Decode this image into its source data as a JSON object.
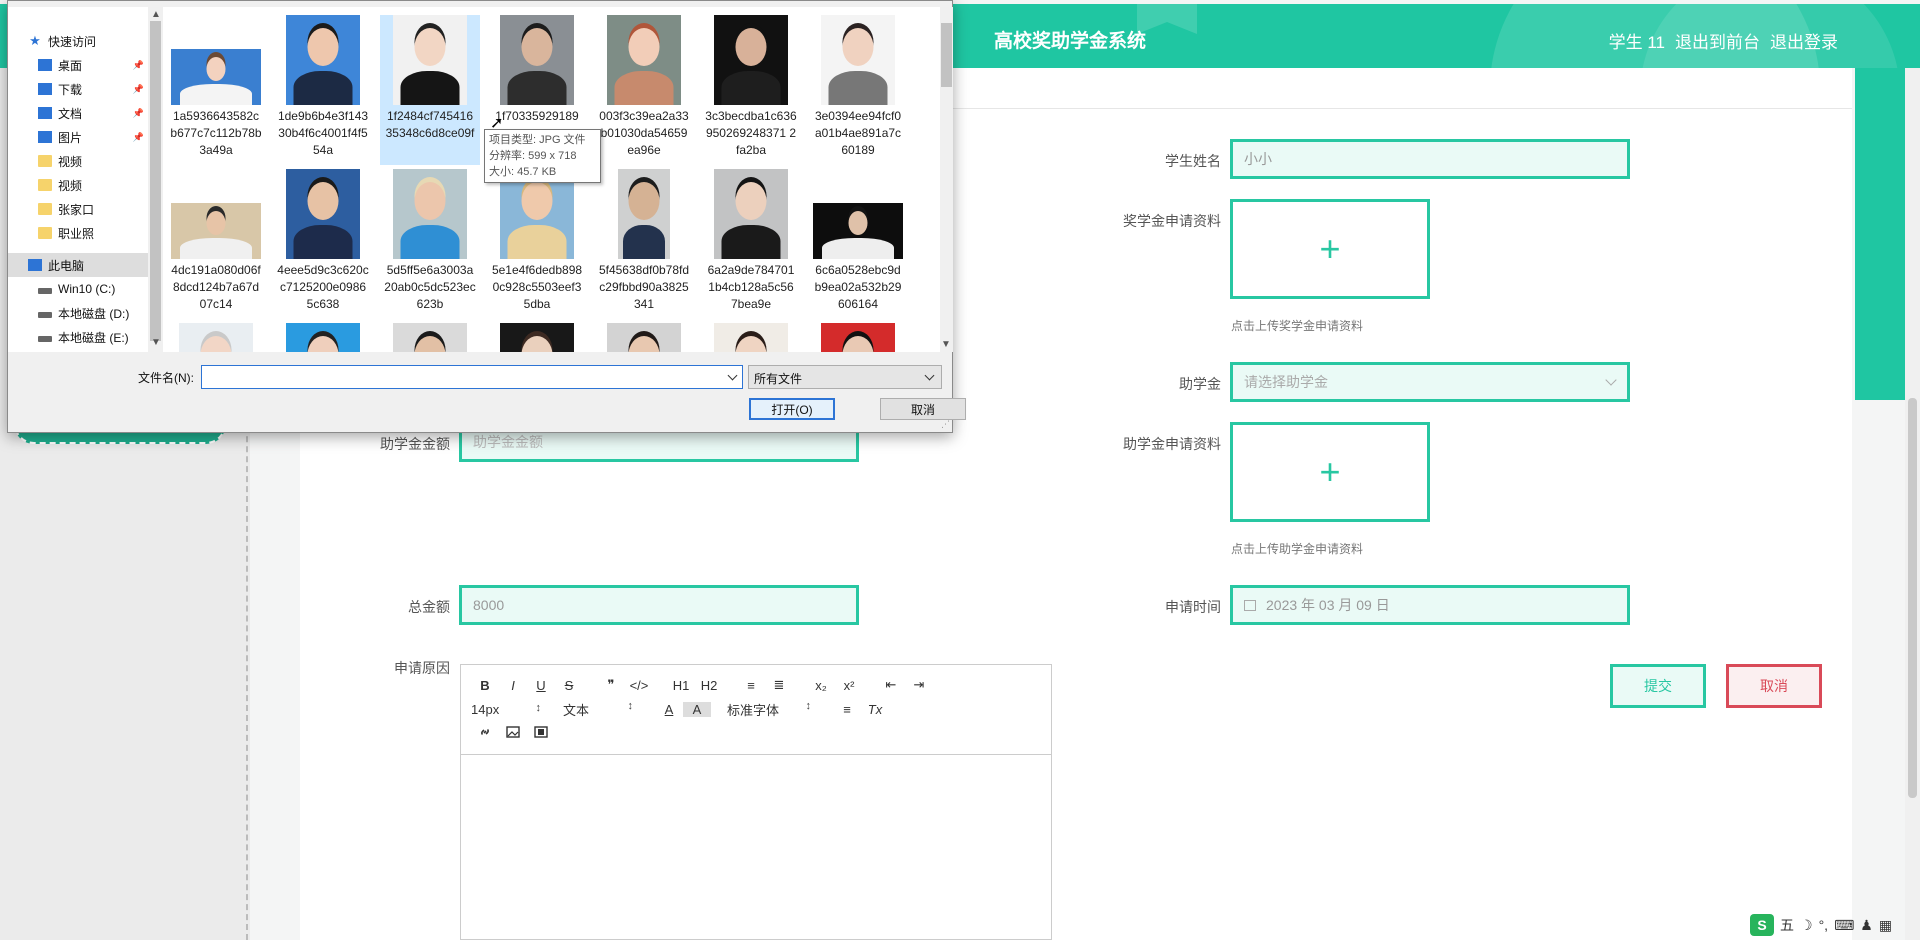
{
  "header": {
    "title": "高校奖助学金系统",
    "nav": [
      "学生 11",
      "退出到前台",
      "退出登录"
    ]
  },
  "form": {
    "student_name_label": "学生姓名",
    "student_name_value": "小小",
    "scholarship_material_label": "奖学金申请资料",
    "scholarship_hint": "点击上传奖学金申请资料",
    "grant_label": "助学金",
    "grant_placeholder": "请选择助学金",
    "grant_material_label": "助学金申请资料",
    "grant_hint": "点击上传助学金申请资料",
    "grant_amount_label": "助学金金额",
    "grant_amount_placeholder": "助学金金额",
    "total_label": "总金额",
    "total_value": "8000",
    "apply_time_label": "申请时间",
    "apply_time_value": "2023 年 03 月 09 日",
    "reason_label": "申请原因",
    "upload_plus": "+",
    "submit": "提交",
    "cancel": "取消"
  },
  "editor": {
    "row1": [
      "B",
      "I",
      "U",
      "S",
      "❞",
      "</>",
      "H1",
      "H2",
      "≡",
      "≣",
      "x₂",
      "x²",
      "⇤",
      "⇥"
    ],
    "font_size": "14px",
    "block_type": "文本",
    "font_color_icon": "A",
    "bg_color_icon": "A",
    "font_family": "标准字体",
    "align_icon": "≡",
    "clear_icon": "Tx",
    "row3_icons": [
      "link-icon",
      "image-icon",
      "video-icon"
    ]
  },
  "dialog": {
    "nav": [
      {
        "label": "快速访问",
        "icon": "star-icon"
      },
      {
        "label": "桌面",
        "icon": "desktop-icon",
        "pinned": true
      },
      {
        "label": "下载",
        "icon": "download-icon",
        "pinned": true
      },
      {
        "label": "文档",
        "icon": "document-icon",
        "pinned": true
      },
      {
        "label": "图片",
        "icon": "pictures-icon",
        "pinned": true
      },
      {
        "label": "视频",
        "icon": "folder-icon"
      },
      {
        "label": "视频",
        "icon": "folder-icon"
      },
      {
        "label": "张家口",
        "icon": "folder-icon"
      },
      {
        "label": "职业照",
        "icon": "folder-icon"
      },
      {
        "label": "此电脑",
        "icon": "computer-icon"
      },
      {
        "label": "Win10 (C:)",
        "icon": "drive-icon"
      },
      {
        "label": "本地磁盘 (D:)",
        "icon": "drive-icon"
      },
      {
        "label": "本地磁盘 (E:)",
        "icon": "drive-icon"
      }
    ],
    "files": [
      {
        "name": "1a5936643582cb677c7c112b78b3a49a",
        "bg": "#3a7fd0",
        "skin": "#f3d2bf",
        "hair": "#6b4a35",
        "cloth": "#f4f4f4"
      },
      {
        "name": "1de9b6b4e3f14330b4f6c4001f4f554a",
        "bg": "#3e86d8",
        "skin": "#eec7ad",
        "hair": "#1b1b1b",
        "cloth": "#1c2a44"
      },
      {
        "name": "1f2484cf74541635348c6d8ce09f",
        "bg": "#f1f1f1",
        "skin": "#f2d6c4",
        "hair": "#222",
        "cloth": "#151515"
      },
      {
        "name": "1f70335929189",
        "bg": "#8a8f94",
        "skin": "#d9b59c",
        "hair": "#1c1c1c",
        "cloth": "#2d2d2d"
      },
      {
        "name": "003f3c39ea2a33b01030da54659ea96e",
        "bg": "#7e8d86",
        "skin": "#f2cdb8",
        "hair": "#b0563a",
        "cloth": "#c78a6d"
      },
      {
        "name": "3c3becdba1c636950269248371 2fa2ba",
        "bg": "#111",
        "skin": "#d8b199",
        "hair": "#111",
        "cloth": "#1e1e1e"
      },
      {
        "name": "3e0394ee94fcf0a01b4ae891a7c60189",
        "bg": "#f4f4f4",
        "skin": "#f0d2c0",
        "hair": "#2b2222",
        "cloth": "#777"
      },
      {
        "name": "4dc191a080d06f8dcd124b7a67d07c14",
        "bg": "#d8c7a8",
        "skin": "#e7c4a7",
        "hair": "#2a2a2a",
        "cloth": "#f0f0f0"
      },
      {
        "name": "4eee5d9c3c620cc7125200e09865c638",
        "bg": "#2d5ea0",
        "skin": "#e7c2a5",
        "hair": "#1a1a1a",
        "cloth": "#1d2b4b"
      },
      {
        "name": "5d5ff5e6a3003a20ab0c5dc523ec623b",
        "bg": "#b6c7cc",
        "skin": "#ecc6ac",
        "hair": "#e7d9b4",
        "cloth": "#2f8fd4"
      },
      {
        "name": "5e1e4f6dedb8980c928c5503eef35dba",
        "bg": "#8ab7d8",
        "skin": "#efc9ab",
        "hair": "#d7b77c",
        "cloth": "#e9d19b"
      },
      {
        "name": "5f45638df0b78fdc29fbbd90a3825341",
        "bg": "#cfd0d0",
        "skin": "#d5b294",
        "hair": "#1d1d1d",
        "cloth": "#23324d"
      },
      {
        "name": "6a2a9de7847011b4cb128a5c567bea9e",
        "bg": "#c2c3c4",
        "skin": "#ecd0bd",
        "hair": "#141414",
        "cloth": "#1a1a1a"
      },
      {
        "name": "6c6a0528ebc9db9ea02a532b29606164",
        "bg": "#0d0d0d",
        "skin": "#dfc1a9",
        "hair": "#141414",
        "cloth": "#eeeeee"
      },
      {
        "name": "",
        "bg": "#e9eef2",
        "skin": "#f2d6c6",
        "hair": "#c9c9c9",
        "cloth": "#ddd"
      },
      {
        "name": "",
        "bg": "#2a9be0",
        "skin": "#efcfbc",
        "hair": "#222",
        "cloth": "#222"
      },
      {
        "name": "",
        "bg": "#dadada",
        "skin": "#e2c0a5",
        "hair": "#1b1b1b",
        "cloth": "#333"
      },
      {
        "name": "",
        "bg": "#181818",
        "skin": "#ead0bd",
        "hair": "#3d2a22",
        "cloth": "#111"
      },
      {
        "name": "",
        "bg": "#d3d3d3",
        "skin": "#e8c8b0",
        "hair": "#201a18",
        "cloth": "#555"
      },
      {
        "name": "",
        "bg": "#f0ece6",
        "skin": "#efd4c2",
        "hair": "#2a1d18",
        "cloth": "#ccc"
      },
      {
        "name": "",
        "bg": "#d42b2b",
        "skin": "#e9c9b4",
        "hair": "#111",
        "cloth": "#111"
      }
    ],
    "tooltip": {
      "type": "项目类型: JPG 文件",
      "resolution": "分辨率: 599 x 718",
      "size": "大小: 45.7 KB"
    },
    "filename_label": "文件名(N):",
    "filename_value": "",
    "filetype": "所有文件",
    "open_button": "打开(O)",
    "cancel_button": "取消"
  },
  "ime": {
    "logo": "S",
    "items": [
      "五",
      "☽",
      "°,",
      "⌨",
      "♟",
      "▦"
    ]
  }
}
